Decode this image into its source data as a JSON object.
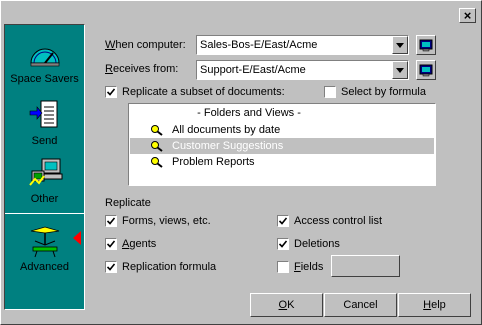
{
  "close_label": "×",
  "sidebar": {
    "items": [
      {
        "label": "Space Savers",
        "icon": "gauge-icon"
      },
      {
        "label": "Send",
        "icon": "send-document-icon"
      },
      {
        "label": "Other",
        "icon": "other-computer-icon"
      },
      {
        "label": "Advanced",
        "icon": "advanced-antenna-icon"
      }
    ]
  },
  "when_computer": {
    "label_pre": "W",
    "label_post": "hen computer:",
    "value": "Sales-Bos-E/East/Acme"
  },
  "receives_from": {
    "label_pre": "R",
    "label_post": "eceives from:",
    "value": "Support-E/East/Acme"
  },
  "subset": {
    "label": "Replicate a subset of documents:",
    "checked": true
  },
  "select_formula": {
    "label": "Select by formula",
    "checked": false
  },
  "list": {
    "header": "- Folders and Views -",
    "items": [
      {
        "label": "All documents by date",
        "selected": false
      },
      {
        "label": "Customer Suggestions",
        "selected": true
      },
      {
        "label": "Problem Reports",
        "selected": false
      }
    ]
  },
  "replicate": {
    "title": "Replicate",
    "forms": {
      "pre": "",
      "label": "Forms, views, etc.",
      "checked": true
    },
    "agents": {
      "pre": "A",
      "label": "gents",
      "checked": true
    },
    "formula": {
      "pre": "",
      "label": "Replication formula",
      "checked": true
    },
    "acl": {
      "pre": "",
      "label": "Access control list",
      "checked": true
    },
    "deletions": {
      "pre": "",
      "label": "Deletions",
      "checked": true
    },
    "fields": {
      "pre": "F",
      "label": "ields",
      "checked": false
    }
  },
  "buttons": {
    "ok_pre": "O",
    "ok_post": "K",
    "cancel": "Cancel",
    "help_pre": "H",
    "help_post": "elp"
  }
}
